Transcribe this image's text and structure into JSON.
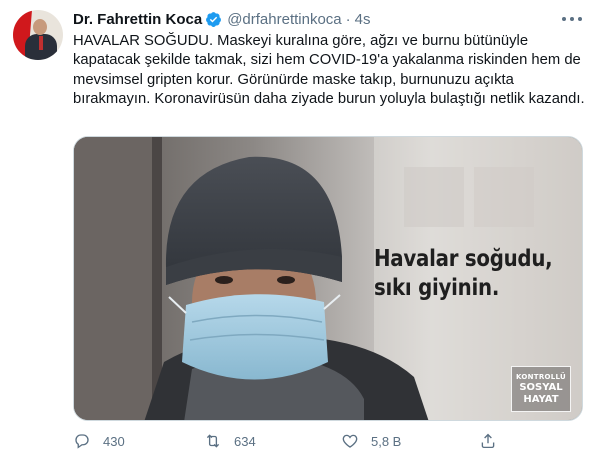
{
  "tweet": {
    "author_name": "Dr. Fahrettin Koca",
    "author_handle": "@drfahrettinkoca",
    "separator": "·",
    "timestamp": "4s",
    "text": "HAVALAR SOĞUDU. Maskeyi kuralına göre, ağzı ve burnu bütünüyle kapatacak şekilde takmak, sizi hem COVID-19'a yakalanma riskinden hem de mevsimsel gripten korur. Görünürde maske takıp, burnunuzu açıkta bırakmayın. Koronavirüsün daha ziyade burun yoluyla bulaştığı netlik kazandı."
  },
  "media": {
    "overlay_line1": "Havalar soğudu,",
    "overlay_line2": "sıkı giyinin.",
    "badge_line1": "KONTROLLÜ",
    "badge_line2": "SOSYAL",
    "badge_line3": "HAYAT"
  },
  "actions": {
    "reply_count": "430",
    "retweet_count": "634",
    "like_count": "5,8 B"
  },
  "icons": {
    "verified": "verified-badge-icon",
    "more": "more-options-icon",
    "reply": "reply-icon",
    "retweet": "retweet-icon",
    "like": "heart-icon",
    "share": "share-icon"
  },
  "colors": {
    "verified": "#1d9bf0",
    "secondary_text": "#5b7083",
    "text": "#0f1419"
  }
}
